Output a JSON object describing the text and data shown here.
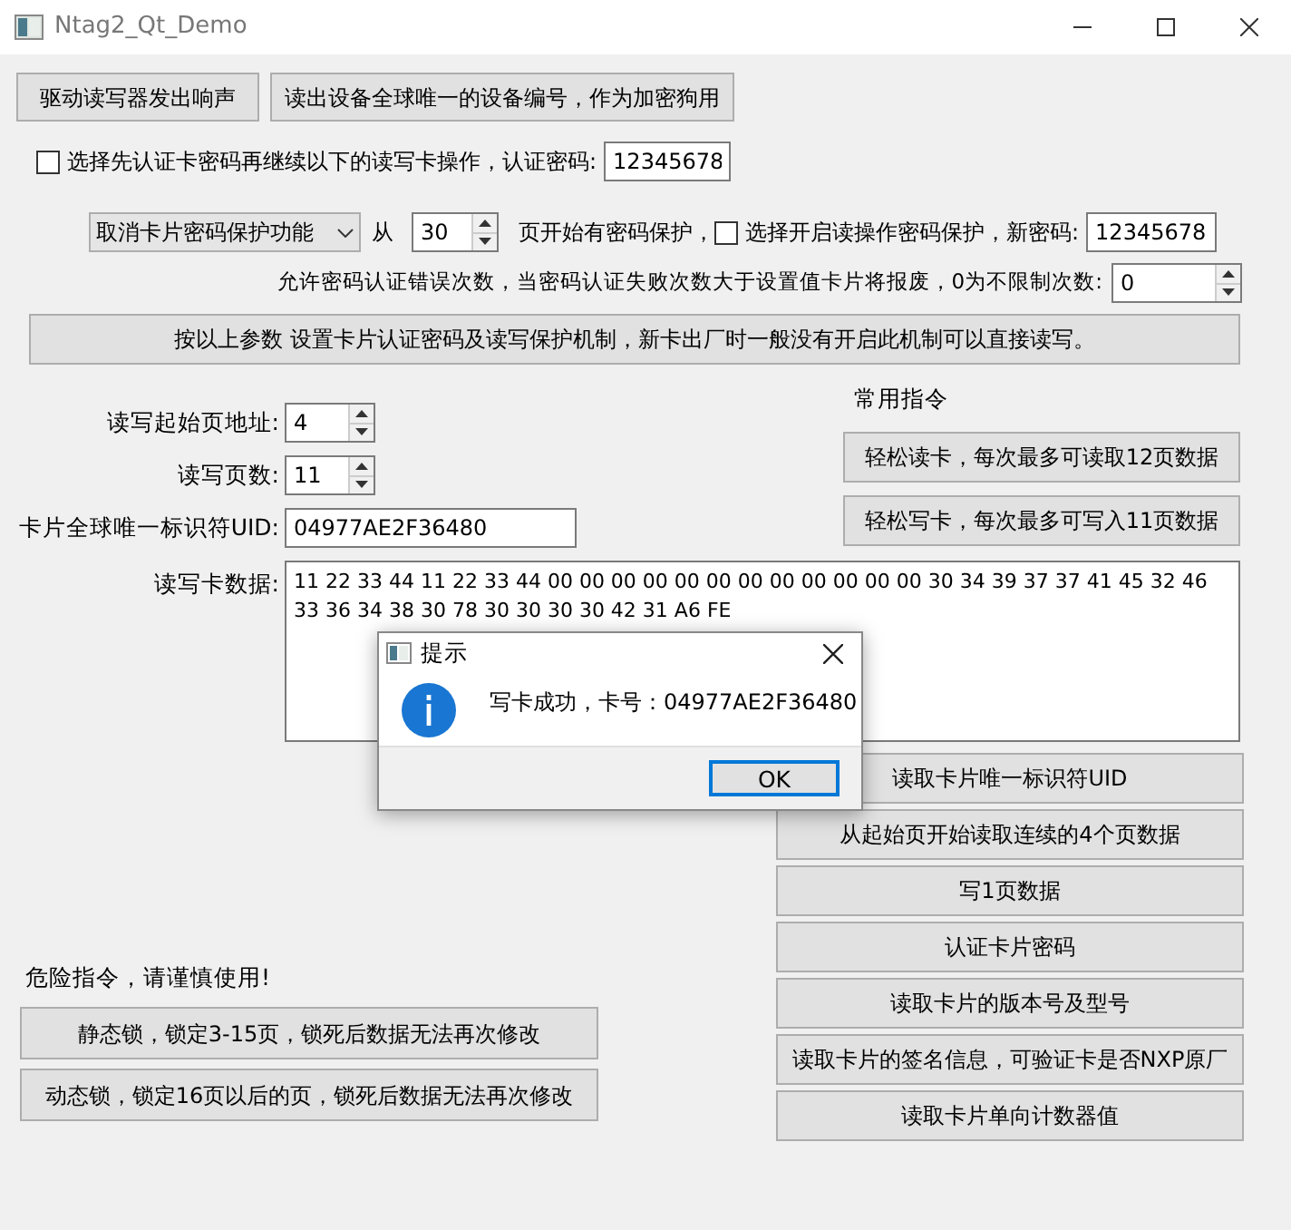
{
  "window": {
    "title": "Ntag2_Qt_Demo"
  },
  "top_buttons": [
    "驱动读写器发出响声",
    "读出设备全球唯一的设备编号，作为加密狗用"
  ],
  "auth": {
    "checked": false,
    "label": "选择先认证卡密码再继续以下的读写卡操作，认证密码:",
    "password": "12345678"
  },
  "protection": {
    "mode": "取消卡片密码保护功能",
    "from_label": "从",
    "from_page": "30",
    "page_text": "页开始有密码保护，",
    "read_protect": {
      "checked": false,
      "label": "选择开启读操作密码保护，新密码:"
    },
    "new_password": "12345678"
  },
  "error_limit": {
    "label": "允许密码认证错误次数，当密码认证失败次数大于设置值卡片将报废，0为不限制次数:",
    "value": "0"
  },
  "set_button": "按以上参数 设置卡片认证密码及读写保护机制，新卡出厂时一般没有开启此机制可以直接读写。",
  "fields": [
    {
      "kind": "spin",
      "label": "读写起始页地址:",
      "value": "4"
    },
    {
      "kind": "spin",
      "label": "读写页数:",
      "value": "11"
    },
    {
      "kind": "text",
      "label": "卡片全球唯一标识符UID:",
      "value": "04977AE2F36480"
    }
  ],
  "common": {
    "title": "常用指令",
    "buttons": [
      "轻松读卡，每次最多可读取12页数据",
      "轻松写卡，每次最多可写入11页数据"
    ]
  },
  "data": {
    "label": "读写卡数据:",
    "value": "11 22 33 44 11 22 33 44 00 00 00 00 00 00 00 00 00 00 00 00 30 34 39 37 37 41 45 32 46 33 36 34 38 30 78 30 30 30 30 42 31 A6 FE"
  },
  "right_buttons": [
    "读取卡片唯一标识符UID",
    "从起始页开始读取连续的4个页数据",
    "写1页数据",
    "认证卡片密码",
    "读取卡片的版本号及型号",
    "读取卡片的签名信息，可验证卡是否NXP原厂",
    "读取卡片单向计数器值"
  ],
  "danger": {
    "title": "危险指令，请谨慎使用!",
    "buttons": [
      "静态锁，锁定3-15页，锁死后数据无法再次修改",
      "动态锁，锁定16页以后的页，锁死后数据无法再次修改"
    ]
  },
  "dialog": {
    "title": "提示",
    "message": "写卡成功，卡号：04977AE2F36480",
    "button": "OK"
  }
}
